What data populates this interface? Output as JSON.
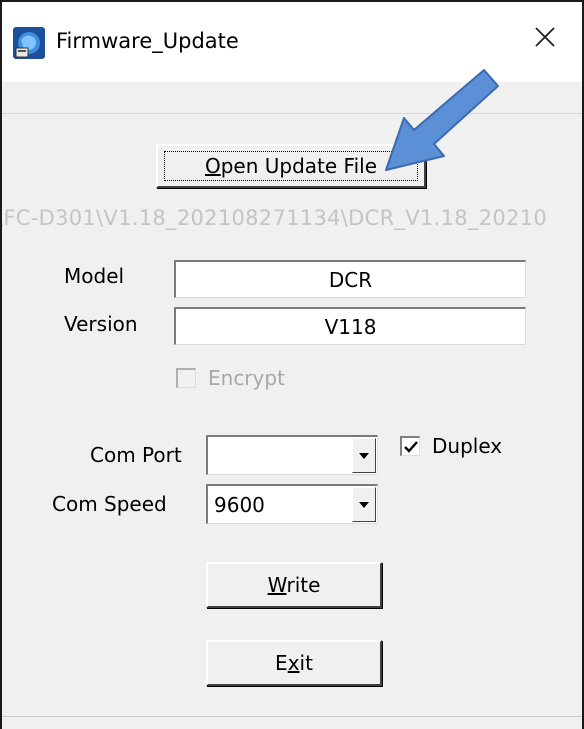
{
  "window": {
    "title": "Firmware_Update",
    "close_glyph": "✕"
  },
  "file": {
    "open_button_label_prefix": "",
    "open_button_mnemonic": "O",
    "open_button_label_rest": "pen Update File",
    "path_text": "\\FC-D301\\V1.18_202108271134\\DCR_V1.18_20210"
  },
  "info": {
    "model_label": "Model",
    "model_value": "DCR",
    "version_label": "Version",
    "version_value": "V118",
    "encrypt_label": "Encrypt",
    "encrypt_checked": false
  },
  "comm": {
    "port_label": "Com Port",
    "port_value": "",
    "duplex_label": "Duplex",
    "duplex_checked": true,
    "speed_label": "Com Speed",
    "speed_value": "9600"
  },
  "actions": {
    "write_mnemonic": "W",
    "write_rest": "rite",
    "exit_first": "E",
    "exit_mnemonic": "x",
    "exit_rest": "it"
  },
  "icons": {
    "app": "firmware-app-icon",
    "close": "close-icon",
    "dropdown": "chevron-down-icon",
    "check": "checkmark-icon",
    "annotation_arrow": "arrow-pointer-icon"
  },
  "colors": {
    "arrow": "#5b8fd6",
    "arrow_stroke": "#3c6ab0"
  }
}
